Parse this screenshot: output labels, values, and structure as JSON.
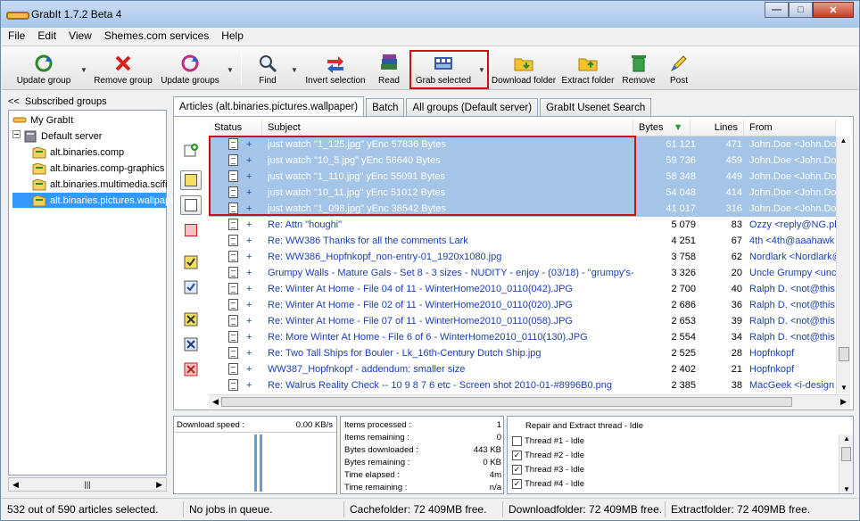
{
  "window": {
    "title": "GrabIt 1.7.2 Beta 4"
  },
  "menu": [
    "File",
    "Edit",
    "View",
    "Shemes.com services",
    "Help"
  ],
  "toolbar": {
    "update_group": "Update group",
    "remove_group": "Remove group",
    "update_groups": "Update groups",
    "find": "Find",
    "invert_selection": "Invert selection",
    "read": "Read",
    "grab_selected": "Grab selected",
    "download_folder": "Download folder",
    "extract_folder": "Extract folder",
    "remove": "Remove",
    "post": "Post"
  },
  "sidebar": {
    "header": "Subscribed groups",
    "collapse_glyph": "<<",
    "root": "My GrabIt",
    "server": "Default server",
    "groups": [
      "alt.binaries.comp",
      "alt.binaries.comp-graphics",
      "alt.binaries.multimedia.scifi",
      "alt.binaries.pictures.wallpaper"
    ]
  },
  "tabs": [
    "Articles (alt.binaries.pictures.wallpaper)",
    "Batch",
    "All groups (Default server)",
    "GrabIt Usenet Search"
  ],
  "columns": {
    "status": "Status",
    "subject": "Subject",
    "bytes": "Bytes",
    "lines": "Lines",
    "from": "From"
  },
  "articles": [
    {
      "subject": "just watch \"1_125.jpg\" yEnc 57836 Bytes",
      "bytes": "61 121",
      "lines": "471",
      "from": "John.Doe <John.Doe",
      "selected": true
    },
    {
      "subject": "just watch \"10_5.jpg\" yEnc 56640 Bytes",
      "bytes": "59 736",
      "lines": "459",
      "from": "John.Doe <John.Doe",
      "selected": true
    },
    {
      "subject": "just watch \"1_110.jpg\" yEnc 55091 Bytes",
      "bytes": "58 348",
      "lines": "449",
      "from": "John.Doe <John.Doe",
      "selected": true
    },
    {
      "subject": "just watch \"10_11.jpg\" yEnc 51012 Bytes",
      "bytes": "54 048",
      "lines": "414",
      "from": "John.Doe <John.Doe",
      "selected": true
    },
    {
      "subject": "just watch \"1_098.jpg\" yEnc 38542 Bytes",
      "bytes": "41 017",
      "lines": "316",
      "from": "John.Doe <John.Doe",
      "selected": true
    },
    {
      "subject": "Re: Attn \"houghi\"",
      "bytes": "5 079",
      "lines": "83",
      "from": "Ozzy <reply@NG.ple",
      "selected": false
    },
    {
      "subject": "Re: WW386 Thanks for all the comments Lark",
      "bytes": "4 251",
      "lines": "67",
      "from": "4th <4th@aaahawk",
      "selected": false
    },
    {
      "subject": "Re: WW386_Hopfnkopf_non-entry-01_1920x1080.jpg",
      "bytes": "3 758",
      "lines": "62",
      "from": "Nordlark <Nordlark@",
      "selected": false
    },
    {
      "subject": "Grumpy Walls - Mature Gals - Set 8 - 3 sizes - NUDITY - enjoy - (03/18) - \"grumpy's-s...",
      "bytes": "3 326",
      "lines": "20",
      "from": "Uncle Grumpy <unc",
      "selected": false
    },
    {
      "subject": "Re: Winter At Home - File 04 of 11 - WinterHome2010_0110(042).JPG",
      "bytes": "2 700",
      "lines": "40",
      "from": "Ralph D. <not@this",
      "selected": false
    },
    {
      "subject": "Re: Winter At Home - File 02 of 11 - WinterHome2010_0110(020).JPG",
      "bytes": "2 686",
      "lines": "36",
      "from": "Ralph D. <not@this",
      "selected": false
    },
    {
      "subject": "Re: Winter At Home - File 07 of 11 - WinterHome2010_0110(058).JPG",
      "bytes": "2 653",
      "lines": "39",
      "from": "Ralph D. <not@this",
      "selected": false
    },
    {
      "subject": "Re: More Winter At Home - File 6 of 6 - WinterHome2010_0110(130).JPG",
      "bytes": "2 554",
      "lines": "34",
      "from": "Ralph D. <not@this",
      "selected": false
    },
    {
      "subject": "Re: Two Tall Ships for Bouler - Lk_16th-Century Dutch Ship.jpg",
      "bytes": "2 525",
      "lines": "28",
      "from": "Hopfnkopf",
      "selected": false
    },
    {
      "subject": "WW387_Hopfnkopf - addendum: smaller size",
      "bytes": "2 402",
      "lines": "21",
      "from": "Hopfnkopf",
      "selected": false
    },
    {
      "subject": "Re: Walrus Reality Check -- 10 9 8 7 6 etc - Screen shot 2010-01-#8996B0.png",
      "bytes": "2 385",
      "lines": "38",
      "from": "MacGeek <i-design",
      "selected": false
    }
  ],
  "download": {
    "label": "Download speed :",
    "value": "0.00 KB/s"
  },
  "stats": [
    {
      "label": "Items processed :",
      "value": "1"
    },
    {
      "label": "Items remaining :",
      "value": "0"
    },
    {
      "label": "Bytes downloaded :",
      "value": "443 KB"
    },
    {
      "label": "Bytes remaining :",
      "value": "0 KB"
    },
    {
      "label": "Time elapsed :",
      "value": "4m"
    },
    {
      "label": "Time remaining :",
      "value": "n/a"
    }
  ],
  "threads": {
    "header": "Repair and Extract thread - Idle",
    "items": [
      {
        "label": "Thread #1 - Idle",
        "checked": false
      },
      {
        "label": "Thread #2 - Idle",
        "checked": true
      },
      {
        "label": "Thread #3 - Idle",
        "checked": true
      },
      {
        "label": "Thread #4 - Idle",
        "checked": true
      }
    ]
  },
  "status": {
    "articles": "532 out of 590 articles selected.",
    "jobs": "No jobs in queue.",
    "cache": "Cachefolder: 72 409MB free.",
    "downloadfolder": "Downloadfolder: 72 409MB free.",
    "extractfolder": "Extractfolder: 72 409MB free."
  },
  "colors": {
    "selection": "#a4c4e8",
    "highlight": "#d01010",
    "link": "#1a3fb0"
  }
}
